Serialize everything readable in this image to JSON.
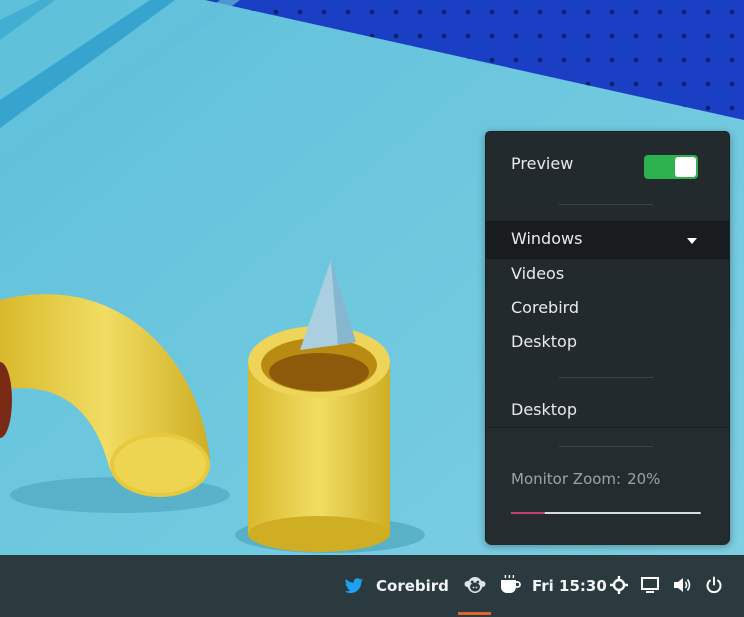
{
  "popover": {
    "preview_label": "Preview",
    "preview_enabled": true,
    "combo_selected": "Windows",
    "options": [
      "Videos",
      "Corebird",
      "Desktop"
    ],
    "current": "Desktop",
    "zoom_label": "Monitor Zoom:",
    "zoom_value": "20%",
    "zoom_fraction": 0.18
  },
  "taskbar": {
    "app_name": "Corebird",
    "clock": "Fri 15:30"
  },
  "icons": {
    "app": "twitter-bird-icon",
    "indicator_1": "monkey-icon",
    "indicator_2": "coffee-cup-icon",
    "network": "network-icon",
    "screen": "screen-icon",
    "sound": "volume-icon",
    "power": "power-icon"
  },
  "colors": {
    "accent_toggle": "#2db250",
    "zoom_fill": "#c13f70",
    "active_indicator": "#e0632f",
    "twitter_blue": "#1da1f2"
  }
}
